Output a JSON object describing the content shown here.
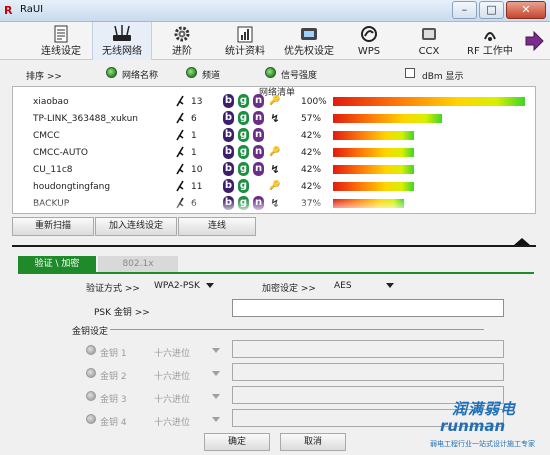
{
  "app": {
    "title": "RaUI",
    "logo_text": "R"
  },
  "window_controls": {
    "minimize": "–",
    "maximize": "□",
    "close": "✕"
  },
  "toolbar": {
    "items": [
      {
        "label": "连线设定",
        "icon": "document-icon"
      },
      {
        "label": "无线网络",
        "icon": "router-icon"
      },
      {
        "label": "进阶",
        "icon": "gear-icon"
      },
      {
        "label": "统计资料",
        "icon": "statistics-icon"
      },
      {
        "label": "优先权设定",
        "icon": "qos-icon"
      },
      {
        "label": "WPS",
        "icon": "wps-icon"
      },
      {
        "label": "CCX",
        "icon": "ccx-icon"
      },
      {
        "label": "RF 工作中",
        "icon": "rf-icon"
      }
    ],
    "active_index": 1,
    "accent": "#7a2d8c"
  },
  "sort": {
    "label": "排序 >>",
    "options": [
      "网络名称",
      "频道",
      "信号强度"
    ],
    "dbm_label": "dBm 显示"
  },
  "network_list": {
    "title": "网络清单",
    "rows": [
      {
        "ssid": "xiaobao",
        "channel": "13",
        "b": true,
        "g": true,
        "n": true,
        "security": "key",
        "percent": "100%",
        "level": 100
      },
      {
        "ssid": "TP-LINK_363488_xukun",
        "channel": "6",
        "b": true,
        "g": true,
        "n": true,
        "security": "wps",
        "percent": "57%",
        "level": 57
      },
      {
        "ssid": "CMCC",
        "channel": "1",
        "b": true,
        "g": true,
        "n": true,
        "security": "",
        "percent": "42%",
        "level": 42
      },
      {
        "ssid": "CMCC-AUTO",
        "channel": "1",
        "b": true,
        "g": true,
        "n": true,
        "security": "key",
        "percent": "42%",
        "level": 42
      },
      {
        "ssid": "CU_11c8",
        "channel": "10",
        "b": true,
        "g": true,
        "n": true,
        "security": "wps",
        "percent": "42%",
        "level": 42
      },
      {
        "ssid": "houdongtingfang",
        "channel": "11",
        "b": true,
        "g": true,
        "n": false,
        "security": "key",
        "percent": "42%",
        "level": 42
      },
      {
        "ssid": "BACKUP",
        "channel": "6",
        "b": true,
        "g": true,
        "n": true,
        "security": "wps",
        "percent": "37%",
        "level": 37
      }
    ]
  },
  "actions": {
    "rescan": "重新扫描",
    "add_profile": "加入连线设定",
    "connect": "连线"
  },
  "tabs": {
    "auth": "验证 \\ 加密",
    "dot1x": "802.1x"
  },
  "security": {
    "auth_label": "验证方式 >>",
    "auth_value": "WPA2-PSK",
    "enc_label": "加密设定 >>",
    "enc_value": "AES",
    "psk_label": "PSK 金钥 >>",
    "psk_value": ""
  },
  "wep": {
    "group_title": "金钥设定",
    "keys": [
      {
        "label": "金钥 1",
        "format": "十六进位"
      },
      {
        "label": "金钥 2",
        "format": "十六进位"
      },
      {
        "label": "金钥 3",
        "format": "十六进位"
      },
      {
        "label": "金钥 4",
        "format": "十六进位"
      }
    ]
  },
  "footer": {
    "ok": "确定",
    "cancel": "取消"
  },
  "watermark": {
    "title": "润满弱电",
    "subtitle": "runman",
    "tagline": "弱电工程行业一站式设计施工专家"
  }
}
